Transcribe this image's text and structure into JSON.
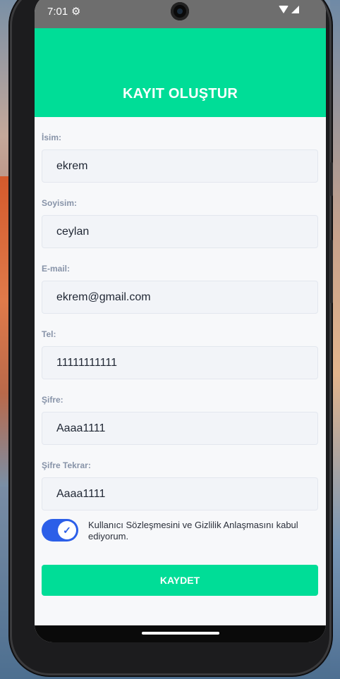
{
  "status_bar": {
    "time": "7:01",
    "settings_icon": "gear-icon",
    "wifi_icon": "wifi-icon",
    "signal_icon": "signal-icon"
  },
  "header": {
    "title": "KAYIT OLUŞTUR"
  },
  "form": {
    "fields": [
      {
        "label": "İsim:",
        "value": "ekrem"
      },
      {
        "label": "Soyisim:",
        "value": "ceylan"
      },
      {
        "label": "E-mail:",
        "value": "ekrem@gmail.com"
      },
      {
        "label": "Tel:",
        "value": "11111111111"
      },
      {
        "label": "Şifre:",
        "value": "Aaaa1111"
      },
      {
        "label": "Şifre Tekrar:",
        "value": "Aaaa1111"
      }
    ],
    "agreement": {
      "text": "Kullanıcı Sözleşmesini ve Gizlilik Anlaşmasını kabul ediyorum.",
      "checked": true,
      "accent": "#2c5fe8"
    },
    "submit_label": "KAYDET"
  },
  "colors": {
    "accent": "#00dd97",
    "toggle": "#2c5fe8"
  }
}
